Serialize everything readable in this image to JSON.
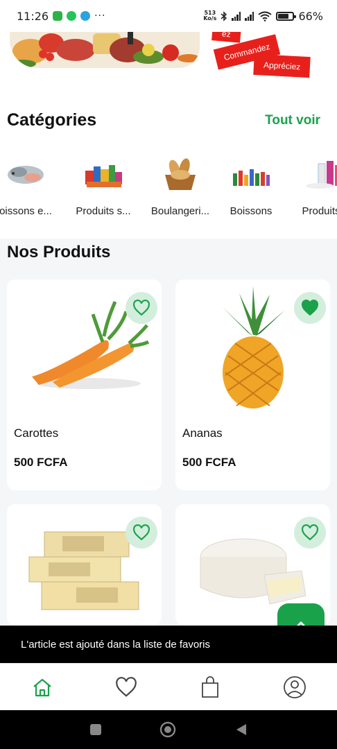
{
  "status_bar": {
    "time": "11:26",
    "more": "···",
    "net_speed_value": "513",
    "net_speed_unit": "Ko/s",
    "battery_pct": "66%",
    "battery_level": 0.66
  },
  "banner": {
    "tags": [
      "ez",
      "Commandez",
      "Appréciez"
    ]
  },
  "categories": {
    "title": "Catégories",
    "see_all": "Tout voir",
    "items": [
      {
        "label": "oissons e...",
        "icon": "seafood-image"
      },
      {
        "label": "Produits s...",
        "icon": "grocery-products-image"
      },
      {
        "label": "Boulangeri...",
        "icon": "bread-basket-image"
      },
      {
        "label": "Boissons",
        "icon": "drinks-image"
      },
      {
        "label": "Produits",
        "icon": "household-products-image"
      }
    ]
  },
  "products": {
    "title": "Nos Produits",
    "items": [
      {
        "name": "Carottes",
        "price": "500 FCFA",
        "favorite": false,
        "image": "carrots-image"
      },
      {
        "name": "Ananas",
        "price": "500 FCFA",
        "favorite": true,
        "image": "pineapple-image"
      },
      {
        "name": "",
        "price": "",
        "favorite": false,
        "image": "butter-image"
      },
      {
        "name": "",
        "price": "",
        "favorite": false,
        "image": "brie-cheese-image"
      }
    ]
  },
  "snackbar": {
    "message": "L'article est ajouté dans la liste de favoris"
  },
  "bottom_nav": {
    "items": [
      {
        "icon": "home-icon",
        "active": true
      },
      {
        "icon": "heart-icon",
        "active": false
      },
      {
        "icon": "shopping-bag-icon",
        "active": false
      },
      {
        "icon": "profile-icon",
        "active": false
      }
    ]
  },
  "colors": {
    "accent": "#1aa24b",
    "favorite_bg": "#d4eedd",
    "tag_red": "#e8201b",
    "snackbar_bg": "#000000"
  }
}
